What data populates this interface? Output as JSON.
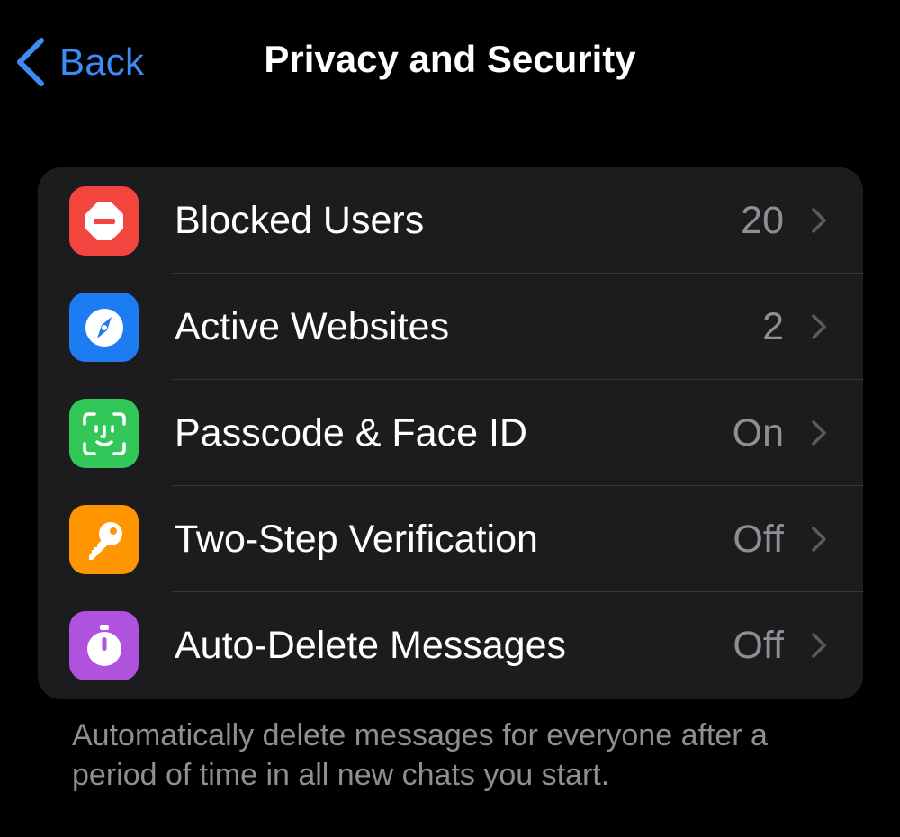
{
  "nav": {
    "back_label": "Back",
    "title": "Privacy and Security"
  },
  "colors": {
    "accent": "#3d8bf5",
    "background": "#000000",
    "group_background": "#1c1c1e",
    "secondary_text": "#8e8e93"
  },
  "settings": {
    "items": [
      {
        "label": "Blocked Users",
        "value": "20",
        "icon": "no-entry-icon",
        "icon_color": "#f2453d"
      },
      {
        "label": "Active Websites",
        "value": "2",
        "icon": "compass-icon",
        "icon_color": "#1e7cf2"
      },
      {
        "label": "Passcode & Face ID",
        "value": "On",
        "icon": "face-id-icon",
        "icon_color": "#33c759"
      },
      {
        "label": "Two-Step Verification",
        "value": "Off",
        "icon": "key-icon",
        "icon_color": "#ff9500"
      },
      {
        "label": "Auto-Delete Messages",
        "value": "Off",
        "icon": "timer-icon",
        "icon_color": "#af52de"
      }
    ]
  },
  "footer": {
    "note": "Automatically delete messages for everyone after a period of time in all new chats you start."
  }
}
